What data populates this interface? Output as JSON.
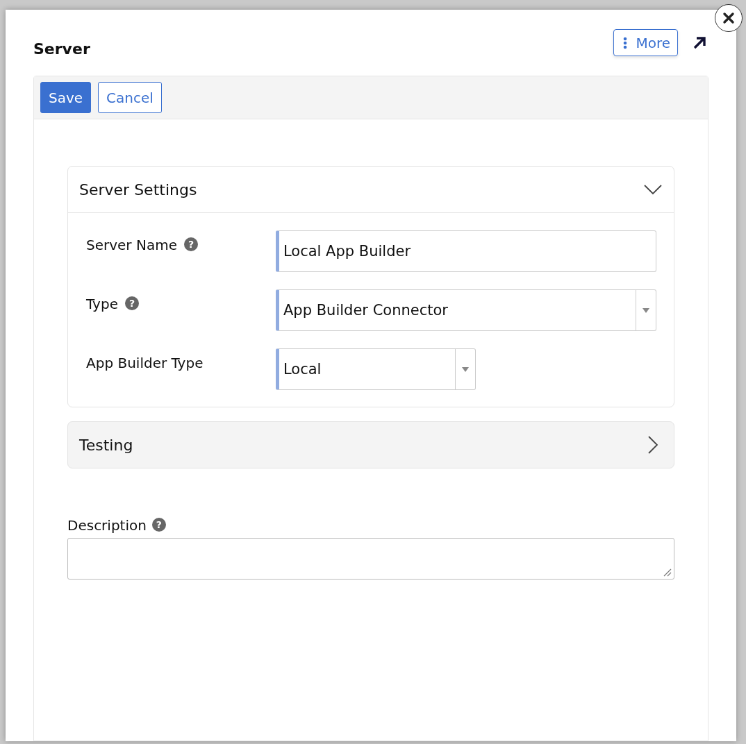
{
  "dialog": {
    "title": "Server",
    "more_button": "More"
  },
  "toolbar": {
    "buttons": [
      {
        "label": "Save",
        "kind": "primary"
      },
      {
        "label": "Cancel",
        "kind": "secondary"
      }
    ]
  },
  "sections": [
    {
      "title": "Server Settings",
      "expanded": true,
      "fields": [
        {
          "label": "Server Name",
          "help": "?",
          "kind": "text",
          "value": "Local App Builder"
        },
        {
          "label": "Type",
          "help": "?",
          "kind": "select",
          "value": "App Builder Connector"
        },
        {
          "label": "App Builder Type",
          "kind": "short-select",
          "value": "Local"
        }
      ]
    },
    {
      "title": "Testing",
      "expanded": false
    }
  ],
  "description": {
    "label": "Description",
    "help": "?"
  }
}
